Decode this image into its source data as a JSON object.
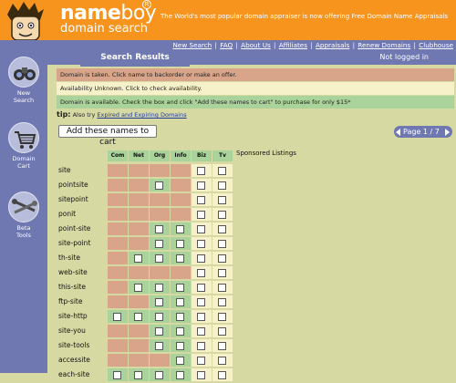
{
  "brand": {
    "name_part1": "name",
    "name_part2": "boy",
    "registered": "R",
    "subtitle": "domain search",
    "tagline": "The World's most popular domain appraiser is now offering Free Domain Name Appraisals"
  },
  "nav": {
    "links": [
      "New Search",
      "FAQ",
      "About Us",
      "Affiliates",
      "Appraisals",
      "Renew Domains",
      "Clubhouse"
    ],
    "separator": "|"
  },
  "section_title": "Search Results",
  "login_status": "Not logged in",
  "sidebar": {
    "items": [
      {
        "label1": "New",
        "label2": "Search",
        "icon": "binoculars-icon"
      },
      {
        "label1": "Domain",
        "label2": "Cart",
        "icon": "shopping-cart-icon"
      },
      {
        "label1": "Beta",
        "label2": "Tools",
        "icon": "tools-icon"
      }
    ]
  },
  "messages": {
    "taken": "Domain is taken. Click name to backorder or make an offer.",
    "unknown": "Availability Unknown. Click to check availability.",
    "available": "Domain is available. Check the box and click \"Add these names to cart\" to purchase for only $15*"
  },
  "tip": {
    "label": "tip:",
    "text": "Also try",
    "link": "Expired and Expiring Domains"
  },
  "add_button": "Add these names to cart",
  "pagination": "Page 1 / 7",
  "sponsored_label": "Sponsored Listings",
  "colors": {
    "taken": "#d8a58a",
    "available": "#a9d39a",
    "unknown": "#f6f1c9",
    "accent_orange": "#f7941d",
    "nav_purple": "#6f78b0"
  },
  "table": {
    "columns": [
      "Com",
      "Net",
      "Org",
      "Info",
      "Biz",
      "Tv"
    ],
    "rows": [
      {
        "name": "site",
        "status": [
          "t",
          "t",
          "t",
          "t",
          "u",
          "u"
        ]
      },
      {
        "name": "pointsite",
        "status": [
          "t",
          "t",
          "a",
          "t",
          "u",
          "u"
        ]
      },
      {
        "name": "sitepoint",
        "status": [
          "t",
          "t",
          "t",
          "t",
          "u",
          "u"
        ]
      },
      {
        "name": "ponit",
        "status": [
          "t",
          "t",
          "t",
          "t",
          "u",
          "u"
        ]
      },
      {
        "name": "point-site",
        "status": [
          "t",
          "t",
          "a",
          "a",
          "u",
          "u"
        ]
      },
      {
        "name": "site-point",
        "status": [
          "t",
          "t",
          "a",
          "a",
          "u",
          "u"
        ]
      },
      {
        "name": "th-site",
        "status": [
          "t",
          "a",
          "a",
          "a",
          "u",
          "u"
        ]
      },
      {
        "name": "web-site",
        "status": [
          "t",
          "t",
          "t",
          "t",
          "u",
          "u"
        ]
      },
      {
        "name": "this-site",
        "status": [
          "t",
          "a",
          "a",
          "a",
          "u",
          "u"
        ]
      },
      {
        "name": "ftp-site",
        "status": [
          "t",
          "t",
          "a",
          "a",
          "u",
          "u"
        ]
      },
      {
        "name": "site-http",
        "status": [
          "a",
          "a",
          "a",
          "a",
          "u",
          "u"
        ]
      },
      {
        "name": "site-you",
        "status": [
          "t",
          "t",
          "a",
          "a",
          "u",
          "u"
        ]
      },
      {
        "name": "site-tools",
        "status": [
          "t",
          "t",
          "a",
          "a",
          "u",
          "u"
        ]
      },
      {
        "name": "accessite",
        "status": [
          "t",
          "t",
          "t",
          "a",
          "u",
          "u"
        ]
      },
      {
        "name": "each-site",
        "status": [
          "a",
          "a",
          "a",
          "a",
          "u",
          "u"
        ]
      }
    ]
  }
}
